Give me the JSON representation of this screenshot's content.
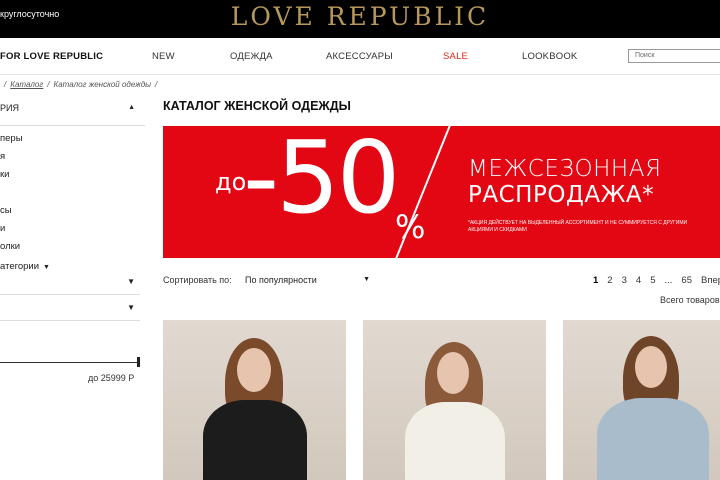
{
  "topbar": {
    "hours": "круглосуточно",
    "logo": "LOVE REPUBLIC"
  },
  "nav": {
    "brand": "FOR LOVE REPUBLIC",
    "items": [
      "NEW",
      "ОДЕЖДА",
      "АКСЕССУАРЫ",
      "SALE",
      "LOOKBOOK"
    ],
    "search_placeholder": "Поиск"
  },
  "breadcrumb": {
    "items": [
      "Каталог",
      "Каталог женской одежды"
    ]
  },
  "sidebar": {
    "heading": "РИЯ",
    "categories": [
      "перы",
      "я",
      "ки",
      "",
      "сы",
      "и",
      "олки"
    ],
    "more_categories": "атегории",
    "price_max": "до 25999 Р"
  },
  "main": {
    "title": "КАТАЛОГ ЖЕНСКОЙ ОДЕЖДЫ",
    "banner": {
      "prefix": "до",
      "discount": "-50",
      "percent": "%",
      "headline_1": "МЕЖСЕЗОННАЯ",
      "headline_2": "РАСПРОДАЖА*",
      "fine_print": "*АКЦИЯ ДЕЙСТВУЕТ НА ВЫДЕЛЕННЫЙ АССОРТИМЕНТ И НЕ СУММИРУЕТСЯ С ДРУГИМИ АКЦИЯМИ И СКИДКАМИ",
      "background_color": "#e30613"
    },
    "sort_label": "Сортировать по:",
    "sort_value": "По популярности",
    "pagination": [
      "1",
      "2",
      "3",
      "4",
      "5",
      "...",
      "65",
      "Вперёд"
    ],
    "current_page": "1",
    "total": "Всего товаров"
  },
  "products": [
    {
      "outfit": "black-blazer"
    },
    {
      "outfit": "white-blazer"
    },
    {
      "outfit": "denim-jacket"
    }
  ]
}
